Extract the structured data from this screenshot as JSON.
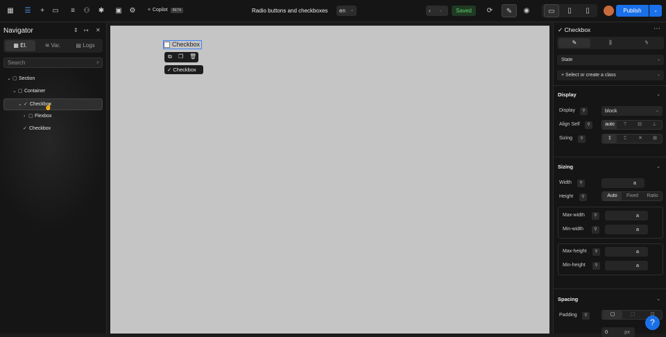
{
  "topbar": {
    "copilot_label": "Copilot",
    "beta_badge": "BETA",
    "doc_title": "Radio buttons and checkboxes",
    "language": "en",
    "saved_label": "Saved",
    "publish_label": "Publish"
  },
  "navigator": {
    "title": "Navigator",
    "tabs": [
      {
        "label": "El."
      },
      {
        "label": "Var."
      },
      {
        "label": "Logs"
      }
    ],
    "search_placeholder": "Search",
    "tree": [
      {
        "label": "Section"
      },
      {
        "label": "Container"
      },
      {
        "label": "Checkbox"
      },
      {
        "label": "Flexbox"
      },
      {
        "label": "Checkbox"
      }
    ]
  },
  "canvas": {
    "checkbox_label": "Checkbox",
    "selected_tag": "Checkbox"
  },
  "panel": {
    "title": "Checkbox",
    "state_label": "State",
    "class_placeholder": "Select or create a class",
    "display_section": {
      "header": "Display",
      "display_label": "Display",
      "display_value": "block",
      "align_self_label": "Align Self",
      "align_self_value": "auto",
      "sizing_label": "Sizing"
    },
    "sizing_section": {
      "header": "Sizing",
      "width_label": "Width",
      "width_unit": "a",
      "height_label": "Height",
      "height_options": [
        "Auto",
        "Fixed",
        "Ratio"
      ],
      "max_width_label": "Max-width",
      "min_width_label": "Min-width",
      "max_height_label": "Max-height",
      "min_height_label": "Min-height",
      "unit": "a"
    },
    "spacing_section": {
      "header": "Spacing",
      "padding_label": "Padding",
      "padding_value": "0",
      "padding_unit": "px"
    }
  },
  "help_label": "?"
}
